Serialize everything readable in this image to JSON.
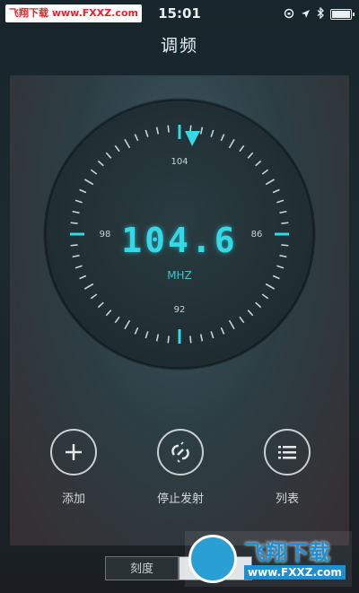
{
  "status_bar": {
    "watermark": "飞翔下载 www.FXXZ.com",
    "time": "15:01",
    "icons": [
      "lock-rotation-icon",
      "location-icon",
      "bluetooth-icon",
      "battery-icon"
    ]
  },
  "header": {
    "title": "调频"
  },
  "dial": {
    "frequency": "104.6",
    "unit": "MHZ",
    "scale_labels": {
      "top": "104",
      "bottom": "92",
      "left": "98",
      "right": "86"
    },
    "accent_color": "#33d9e6"
  },
  "controls": [
    {
      "icon": "plus-icon",
      "label": "添加"
    },
    {
      "icon": "broken-link-icon",
      "label": "停止发射"
    },
    {
      "icon": "list-icon",
      "label": "列表"
    }
  ],
  "tabs": [
    {
      "label": "刻度",
      "active": true
    },
    {
      "label": "",
      "active": false
    }
  ],
  "watermark": {
    "brand": "飞翔下载",
    "url": "www.FXXZ.com"
  }
}
